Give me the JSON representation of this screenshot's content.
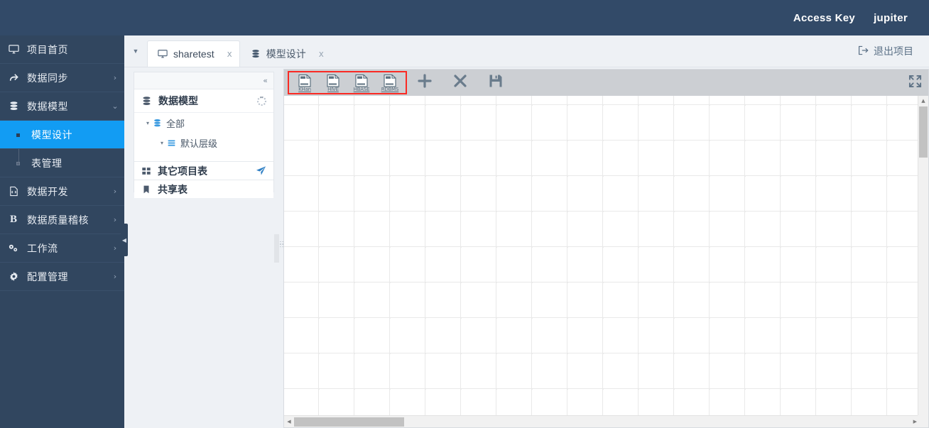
{
  "topbar": {
    "access_key_label": "Access Key",
    "user_label": "jupiter"
  },
  "sidebar": {
    "items": [
      {
        "label": "项目首页",
        "icon": "monitor-icon",
        "arrow": "",
        "expanded": false
      },
      {
        "label": "数据同步",
        "icon": "sync-arrow-icon",
        "arrow": "›",
        "expanded": false
      },
      {
        "label": "数据模型",
        "icon": "database-icon",
        "arrow": "⌄",
        "expanded": true
      },
      {
        "label": "数据开发",
        "icon": "code-file-icon",
        "arrow": "›",
        "expanded": false
      },
      {
        "label": "数据质量稽核",
        "icon": "letter-b-icon",
        "arrow": "›",
        "expanded": false
      },
      {
        "label": "工作流",
        "icon": "gears-icon",
        "arrow": "›",
        "expanded": false
      },
      {
        "label": "配置管理",
        "icon": "gear-icon",
        "arrow": "›",
        "expanded": false
      }
    ],
    "sub_items": [
      {
        "label": "模型设计",
        "active": true
      },
      {
        "label": "表管理",
        "active": false
      }
    ],
    "collapse_handle_icon": "chevron-left-icon",
    "active_color": "#129cf3",
    "background_color": "#31465f"
  },
  "tabs": {
    "caret_icon": "caret-down-icon",
    "items": [
      {
        "label": "sharetest",
        "icon": "monitor-icon",
        "close": "x",
        "active": true
      },
      {
        "label": "模型设计",
        "icon": "database-icon",
        "close": "x",
        "active": false
      }
    ]
  },
  "exit_project": {
    "label": "退出项目",
    "icon": "logout-icon"
  },
  "tree_panel": {
    "collapse_icon": "double-chevron-left-icon",
    "header": {
      "label": "数据模型",
      "icon": "database-icon",
      "loading": true
    },
    "nodes": [
      {
        "label": "全部",
        "icon": "database-icon",
        "caret": "▾",
        "level": 1
      },
      {
        "label": "默认层级",
        "icon": "layers-icon",
        "caret": "▾",
        "level": 2
      }
    ],
    "rows": [
      {
        "label": "其它项目表",
        "icon": "grid-squares-icon",
        "action_icon": "send-icon"
      },
      {
        "label": "共享表",
        "icon": "bookmark-icon",
        "action_icon": ""
      }
    ]
  },
  "toolbar": {
    "highlight_color": "#fa2a24",
    "db_buttons": [
      {
        "label": "KHan",
        "icon": "file-db-icon"
      },
      {
        "label": "HIVE",
        "icon": "file-db-icon"
      },
      {
        "label": "HBASE",
        "icon": "file-db-icon"
      },
      {
        "label": "RDBMS",
        "icon": "file-db-icon"
      }
    ],
    "actions": [
      {
        "name": "add",
        "icon": "plus-icon"
      },
      {
        "name": "delete",
        "icon": "close-x-icon"
      },
      {
        "name": "save",
        "icon": "floppy-save-icon"
      }
    ],
    "expand_icon": "expand-arrows-icon"
  },
  "scrollbars": {
    "vertical_up_icon": "▲",
    "horizontal_left_icon": "◀",
    "horizontal_right_icon": "▶"
  }
}
